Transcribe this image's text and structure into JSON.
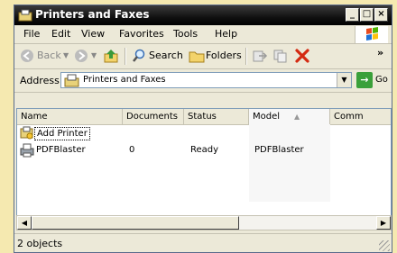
{
  "window": {
    "title": "Printers and Faxes"
  },
  "menu": [
    "File",
    "Edit",
    "View",
    "Favorites",
    "Tools",
    "Help"
  ],
  "toolbar": {
    "back": "Back",
    "search": "Search",
    "folders": "Folders",
    "more": "»"
  },
  "address": {
    "label": "Address",
    "value": "Printers and Faxes",
    "go": "Go"
  },
  "columns": [
    "Name",
    "Documents",
    "Status",
    "Model",
    "Comm"
  ],
  "rows": [
    {
      "name": "Add Printer",
      "documents": "",
      "status": "",
      "model": ""
    },
    {
      "name": "PDFBlaster",
      "documents": "0",
      "status": "Ready",
      "model": "PDFBlaster"
    }
  ],
  "status": {
    "text": "2 objects"
  },
  "icons": [
    "printers-folder-icon",
    "windows-logo-icon",
    "back-arrow-icon",
    "forward-arrow-icon",
    "up-folder-icon",
    "search-icon",
    "folders-icon",
    "move-to-icon",
    "copy-to-icon",
    "delete-icon",
    "add-printer-icon",
    "printer-icon"
  ]
}
